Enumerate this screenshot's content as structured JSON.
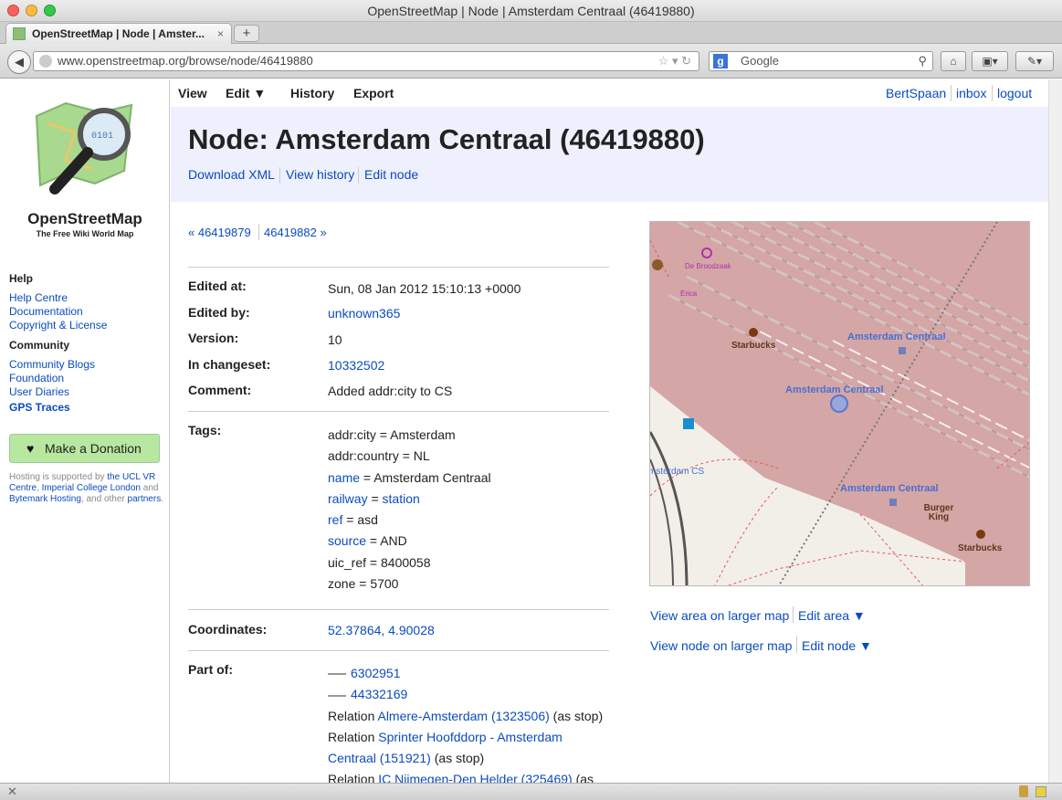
{
  "window": {
    "title": "OpenStreetMap | Node | Amsterdam Centraal (46419880)"
  },
  "tab": {
    "label": "OpenStreetMap | Node | Amster...",
    "close": "×",
    "new_tab": "+"
  },
  "toolbar": {
    "back": "◀",
    "url": "www.openstreetmap.org/browse/node/46419880",
    "search_engine": "g",
    "search_placeholder": "Google",
    "home": "⌂",
    "bookmarks": "▣▾",
    "tools": "✎▾"
  },
  "sidebar": {
    "site_name": "OpenStreetMap",
    "tagline": "The Free Wiki World Map",
    "help_heading": "Help",
    "help_links": [
      "Help Centre",
      "Documentation",
      "Copyright & License"
    ],
    "community_heading": "Community",
    "community_links": [
      "Community Blogs",
      "Foundation",
      "User Diaries"
    ],
    "gps": "GPS Traces",
    "donate": "Make a Donation",
    "hosting": {
      "t1": "Hosting is supported by ",
      "l1": "the UCL VR Centre",
      "t2": ", ",
      "l2": "Imperial College London",
      "t3": " and ",
      "l3": "Bytemark Hosting",
      "t4": ", and other ",
      "l4": "partners",
      "t5": "."
    }
  },
  "nav": {
    "view": "View",
    "edit": "Edit ▼",
    "history": "History",
    "export": "Export",
    "user": "BertSpaan",
    "inbox": "inbox",
    "logout": "logout"
  },
  "header": {
    "title": "Node: Amsterdam Centraal (46419880)",
    "download": "Download XML",
    "history": "View history",
    "edit": "Edit node"
  },
  "pager": {
    "prev": "« 46419879",
    "next": "46419882 »"
  },
  "details": {
    "edited_at_label": "Edited at:",
    "edited_at": "Sun, 08 Jan 2012 15:10:13 +0000",
    "edited_by_label": "Edited by:",
    "edited_by": "unknown365",
    "version_label": "Version:",
    "version": "10",
    "changeset_label": "In changeset:",
    "changeset": "10332502",
    "comment_label": "Comment:",
    "comment": "Added addr:city to CS",
    "tags_label": "Tags:",
    "coords_label": "Coordinates:",
    "coords": "52.37864, 4.90028",
    "part_label": "Part of:"
  },
  "tags": [
    {
      "k": "addr:city",
      "v": "Amsterdam"
    },
    {
      "k": "addr:country",
      "v": "NL"
    },
    {
      "k": "name",
      "v": "Amsterdam Centraal"
    },
    {
      "k": "railway",
      "v": "station"
    },
    {
      "k": "ref",
      "v": "asd"
    },
    {
      "k": "source",
      "v": "AND"
    },
    {
      "k": "uic_ref",
      "v": "8400058"
    },
    {
      "k": "zone",
      "v": "5700"
    }
  ],
  "tag_eq": " = ",
  "part_of": {
    "way1": "6302951",
    "way2": "44332169",
    "relation": "Relation ",
    "r1": "Almere-Amsterdam (1323506)",
    "stop": " (as stop)",
    "r2a": "Sprinter Hoofddorp - Amsterdam",
    "r2b": "Centraal (151921)",
    "r3": "IC Nijmegen-Den Helder (325469)",
    "r3_tail": " (as"
  },
  "map": {
    "labels": [
      "Amsterdam Centraal",
      "Amsterdam Centraal",
      "Amsterdam Centraal",
      "Starbucks",
      "Starbucks",
      "Burger King",
      "De Broodzaak",
      "Erica",
      "msterdam CS"
    ]
  },
  "map_links": {
    "view_area": "View area on larger map",
    "edit_area": "Edit area ▼",
    "view_node": "View node on larger map",
    "edit_node": "Edit node ▼"
  },
  "colors": {
    "link": "#0b4bbf",
    "header_bg": "#eef0fd",
    "station": "#d4a6a6",
    "donate": "#b8e8a0"
  }
}
